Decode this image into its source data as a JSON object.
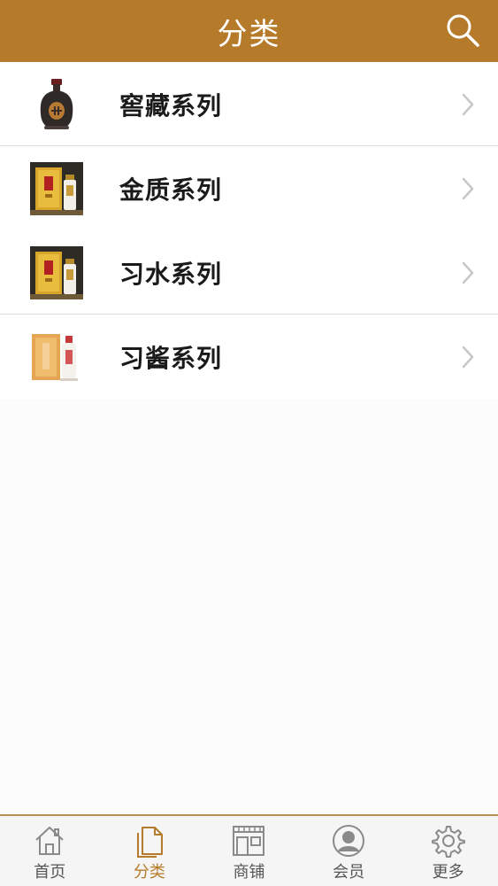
{
  "header": {
    "title": "分类",
    "search_icon": "search-icon",
    "background": "#b67b2a"
  },
  "categories": [
    {
      "label": "窖藏系列",
      "icon": "dark-bottle-image"
    },
    {
      "label": "金质系列",
      "icon": "gold-gift-box-image"
    },
    {
      "label": "习水系列",
      "icon": "gold-gift-box-image"
    },
    {
      "label": "习酱系列",
      "icon": "orange-box-bottle-image"
    }
  ],
  "tabbar": {
    "active": "分类",
    "accent": "#b67b2a",
    "items": [
      {
        "label": "首页",
        "icon": "home-icon"
      },
      {
        "label": "分类",
        "icon": "document-icon"
      },
      {
        "label": "商铺",
        "icon": "store-icon"
      },
      {
        "label": "会员",
        "icon": "user-icon"
      },
      {
        "label": "更多",
        "icon": "gear-icon"
      }
    ]
  }
}
